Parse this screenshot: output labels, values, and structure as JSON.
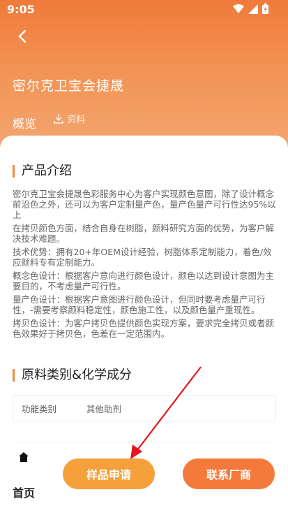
{
  "status_bar": {
    "time": "9:05"
  },
  "header": {
    "title": "密尔克卫宝会捷晟",
    "tabs": [
      {
        "label": "概览"
      },
      {
        "label": "资料"
      }
    ]
  },
  "product_intro": {
    "heading": "产品介绍",
    "paragraphs": [
      "密尔克卫宝会捷晟色彩服务中心为客户实现颜色意图，除了设计概念前沿色之外，还可以为客户定制量产色，量产色量产可行性达95%以上",
      "在拷贝颜色方面，结合自身在树脂，颜料研究方面的优势，为客户解决技术难题。",
      "技术优势：拥有20+年OEM设计经验，树脂体系定制能力，着色/效应颜料专有定制能力。",
      "概念色设计：根据客户意向进行颜色设计，颜色以达到设计意图为主要目的，不考虑量产可行性。",
      "量产色设计：根据客户意图进行颜色设计，但同时要考虑量产可行性，-需要考察颜料稳定性，颜色施工性，以及颜色量产重现性。",
      "拷贝色设计：为客户拷贝色提供颜色实现方案，要求完全拷贝或者颜色效果好于拷贝色，色差在一定范围内。"
    ]
  },
  "materials": {
    "heading": "原料类别&化学成分",
    "rows": [
      {
        "key": "功能类别",
        "value": "其他助剂"
      }
    ]
  },
  "bottom_bar": {
    "home_label": "首页",
    "sample_button": "样品申请",
    "contact_button": "联系厂商"
  },
  "colors": {
    "hero_top": "#f07a3a",
    "accent": "#f28a3a",
    "sample_btn": "#f5a03a",
    "contact_btn": "#f47a3c",
    "annotation_arrow": "#e8141c"
  },
  "icons": [
    "wifi-icon",
    "signal-icon",
    "battery-icon",
    "back-arrow-icon",
    "download-icon",
    "home-icon"
  ]
}
